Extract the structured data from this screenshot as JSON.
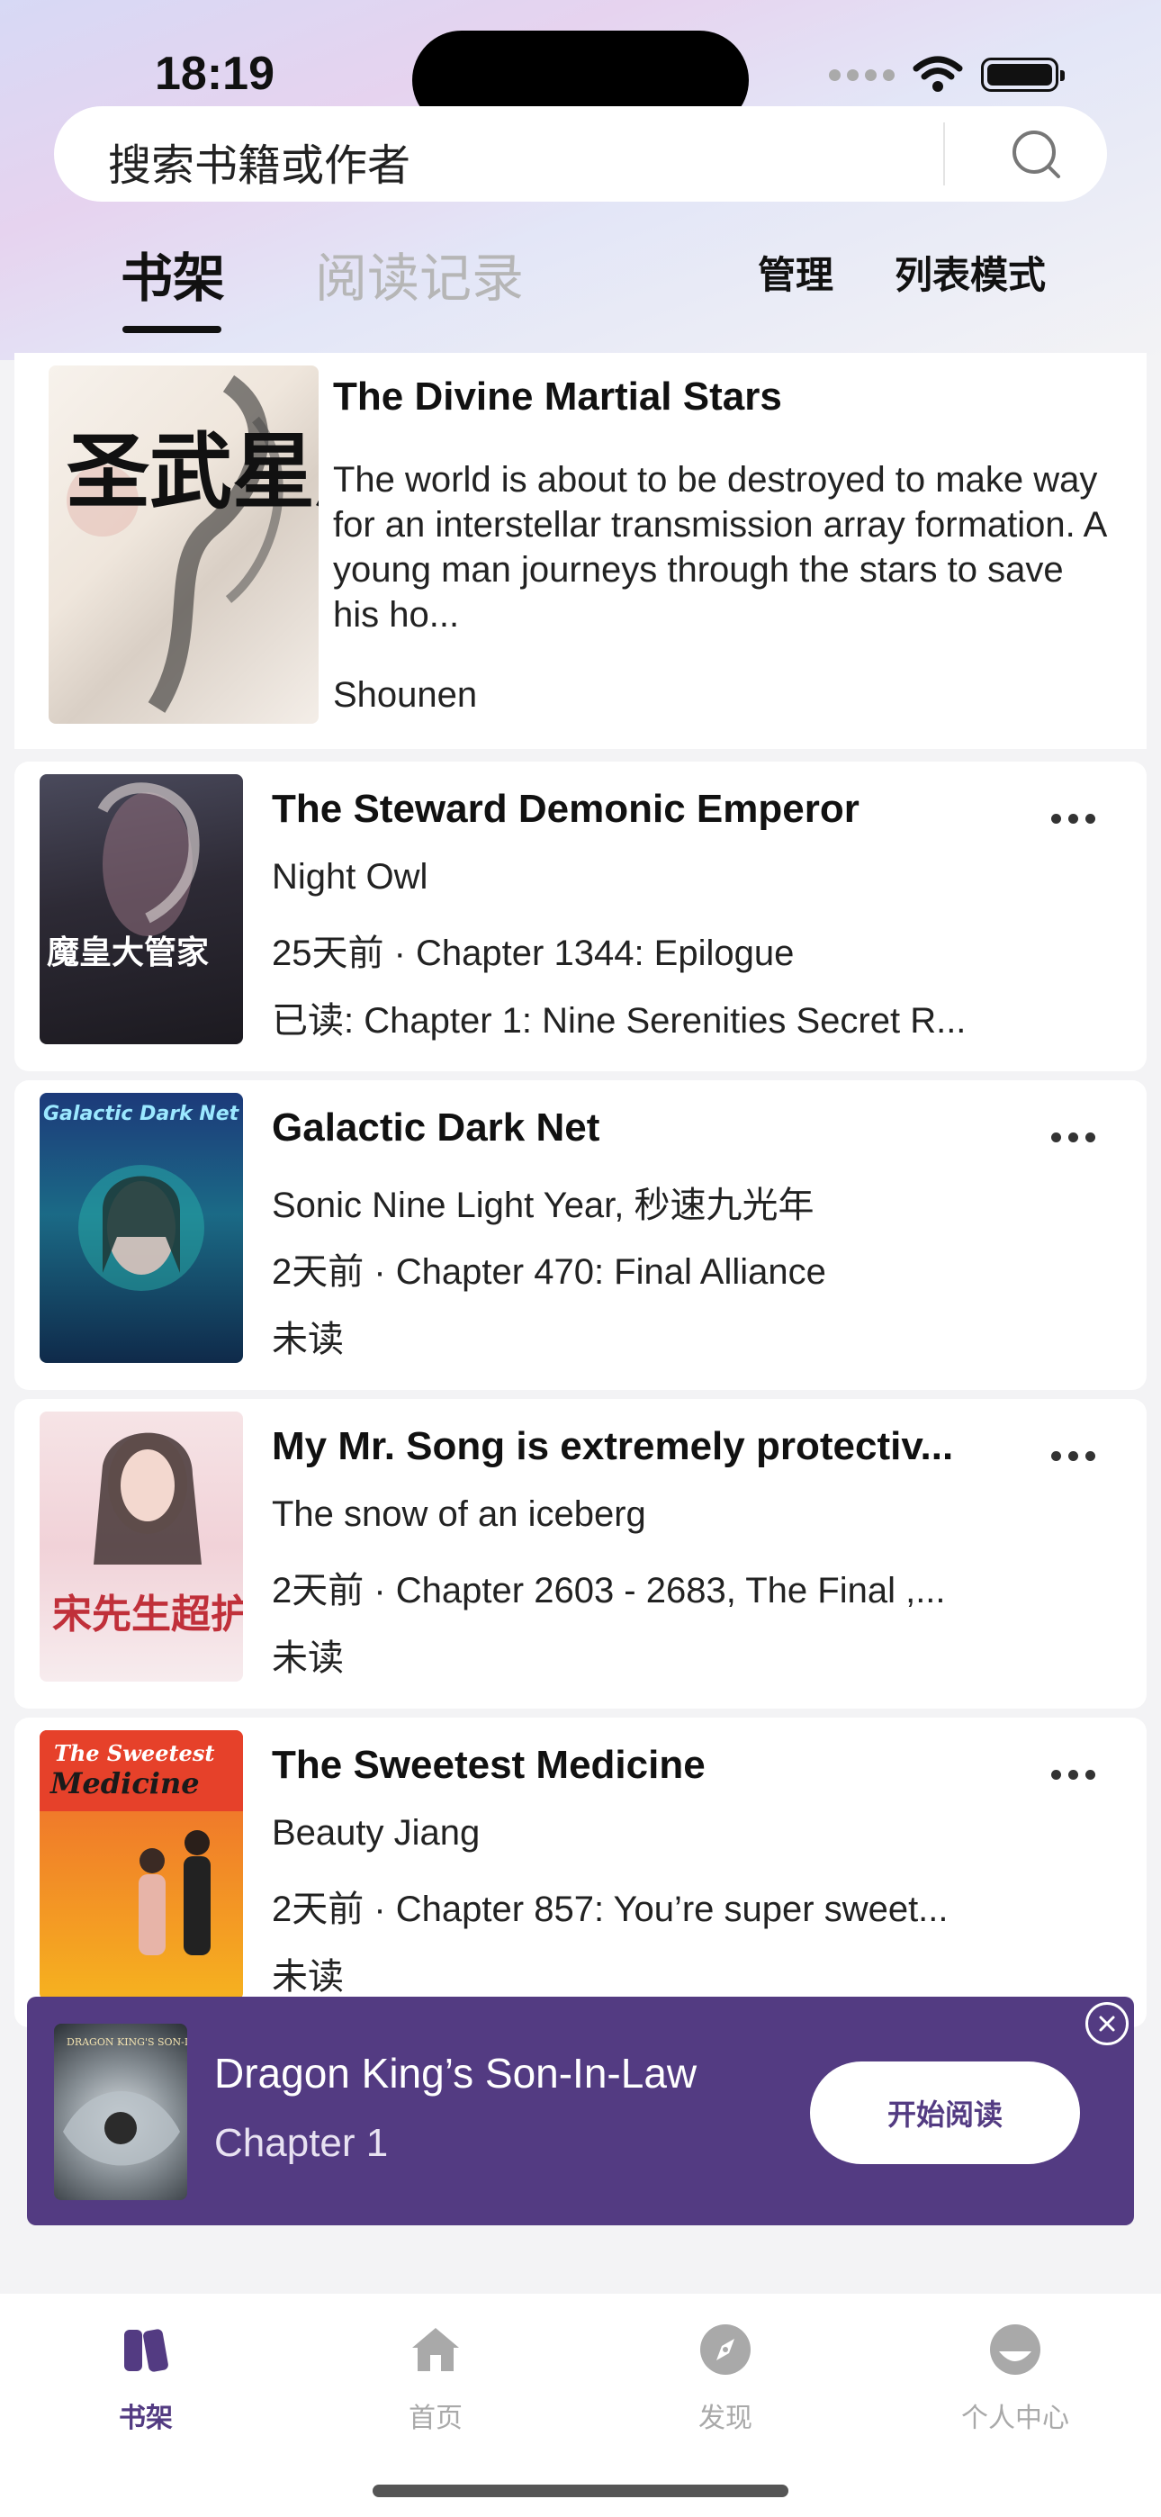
{
  "status_bar": {
    "time": "18:19"
  },
  "search": {
    "placeholder": "搜索书籍或作者"
  },
  "tabs": {
    "shelf": "书架",
    "history": "阅读记录"
  },
  "actions": {
    "manage": "管理",
    "list_mode": "列表模式"
  },
  "featured": {
    "title": "The Divine Martial Stars",
    "description": "The world is about to be destroyed to make way for an interstellar transmission array formation. A young man journeys through the stars to save his ho...",
    "author": "Shounen",
    "cover_text": "圣武星辰"
  },
  "books": [
    {
      "title": "The Steward Demonic Emperor",
      "author": "Night Owl",
      "update": "25天前 · Chapter 1344: Epilogue",
      "status": "已读: Chapter 1: Nine Serenities Secret R...",
      "cover_text": "魔皇大管家"
    },
    {
      "title": "Galactic Dark Net",
      "author": "Sonic Nine Light Year, 秒速九光年",
      "update": "2天前 · Chapter 470: Final Alliance",
      "status": "未读",
      "cover_text": "Galactic Dark Net"
    },
    {
      "title": "My Mr. Song is extremely protectiv...",
      "author": "The snow of an iceberg",
      "update": "2天前 · Chapter 2603 - 2683, The Final ,...",
      "status": "未读",
      "cover_text": "宋先生超护短"
    },
    {
      "title": "The Sweetest Medicine",
      "author": "Beauty Jiang",
      "update": "2天前 · Chapter 857: You’re super sweet...",
      "status": "未读",
      "cover_text": "The Sweetest Medicine"
    }
  ],
  "banner": {
    "title": "Dragon King’s Son-In-Law",
    "chapter": "Chapter 1",
    "button": "开始阅读",
    "cover_text": "DRAGON KING'S SON-IN-LAW"
  },
  "tabbar": [
    {
      "label": "书架",
      "icon": "bookshelf-icon",
      "active": true
    },
    {
      "label": "首页",
      "icon": "home-icon",
      "active": false
    },
    {
      "label": "发现",
      "icon": "compass-icon",
      "active": false
    },
    {
      "label": "个人中心",
      "icon": "profile-icon",
      "active": false
    }
  ],
  "colors": {
    "accent": "#533b82",
    "inactive": "#a9a9a9"
  }
}
